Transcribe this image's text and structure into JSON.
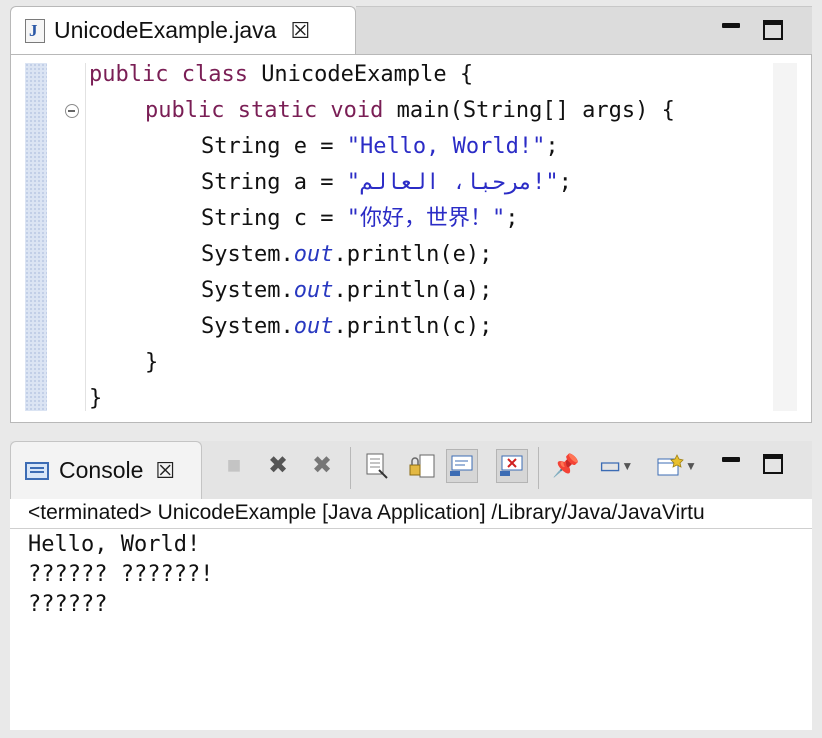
{
  "editor": {
    "tab_title": "UnicodeExample.java",
    "file_icon_letter": "J",
    "close_glyph": "☒",
    "lines": [
      {
        "kw": "public class ",
        "text": "UnicodeExample {"
      },
      {
        "kw": "public static void ",
        "text": "main(String[] args) {"
      },
      {
        "pre": "String e = ",
        "str": "\"Hello, World!\"",
        "post": ";"
      },
      {
        "pre": "String a = ",
        "str": "\"مرحبا، العالم!\"",
        "post": ";"
      },
      {
        "pre": "String c = ",
        "str": "\"你好，世界！\"",
        "post": ";"
      },
      {
        "pre": "System.",
        "fld": "out",
        "post": ".println(e);"
      },
      {
        "pre": "System.",
        "fld": "out",
        "post": ".println(a);"
      },
      {
        "pre": "System.",
        "fld": "out",
        "post": ".println(c);"
      },
      {
        "text": "}"
      },
      {
        "text": "}"
      }
    ]
  },
  "console": {
    "tab_title": "Console",
    "close_glyph": "☒",
    "status_path": "<terminated> UnicodeExample [Java Application] /Library/Java/JavaVirtu",
    "output": [
      "Hello, World!",
      "?????? ??????!",
      "??????"
    ],
    "toolbar_icons": {
      "terminate": "■",
      "remove_launch": "✖",
      "remove_all": "✖",
      "scroll_lock": "▤",
      "pin": "📌",
      "display_selected": "▭",
      "open_console": "▸"
    }
  },
  "colors": {
    "keyword": "#7a1e55",
    "string": "#2b2cc6",
    "field": "#2838c0",
    "gutter": "#dbe4f3"
  }
}
